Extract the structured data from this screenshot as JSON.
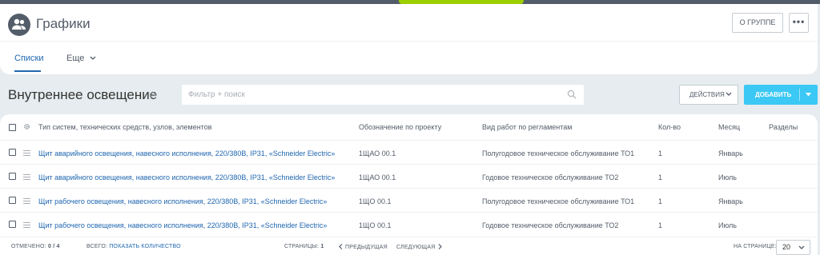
{
  "header": {
    "title": "Графики",
    "about_button": "О ГРУППЕ",
    "more_button": "•••",
    "tabs": [
      {
        "label": "Списки"
      },
      {
        "label": "Еще"
      }
    ]
  },
  "toolbar": {
    "section_title": "Внутреннее освещение",
    "filter_placeholder": "Фильтр + поиск",
    "actions_label": "ДЕЙСТВИЯ",
    "add_label": "ДОБАВИТЬ"
  },
  "grid": {
    "columns": [
      "Тип систем, технических средств, узлов, элементов",
      "Обозначение по проекту",
      "Вид работ по регламентам",
      "Кол-во",
      "Месяц",
      "Разделы"
    ],
    "rows": [
      {
        "name": "Щит аварийного освещения, навесного исполнения, 220/380В, IP31, «Schneider Electric»",
        "designation": "1ЩАО 00.1",
        "work": "Полугодовое техническое обслуживание ТО1",
        "qty": "1",
        "month": "Январь",
        "sections": ""
      },
      {
        "name": "Щит аварийного освещения, навесного исполнения, 220/380В, IP31, «Schneider Electric»",
        "designation": "1ЩАО 00.1",
        "work": "Годовое техническое обслуживание ТО2",
        "qty": "1",
        "month": "Июль",
        "sections": ""
      },
      {
        "name": "Щит рабочего освещения, навесного исполнения, 220/380В, IP31, «Schneider Electric»",
        "designation": "1ЩО 00.1",
        "work": "Полугодовое техническое обслуживание ТО1",
        "qty": "1",
        "month": "Январь",
        "sections": ""
      },
      {
        "name": "Щит рабочего освещения, навесного исполнения, 220/380В, IP31, «Schneider Electric»",
        "designation": "1ЩО 00.1",
        "work": "Годовое техническое обслуживание ТО2",
        "qty": "1",
        "month": "Июль",
        "sections": ""
      }
    ]
  },
  "footer": {
    "selected_label": "ОТМЕЧЕНО:",
    "selected_value": "0 / 4",
    "total_label": "ВСЕГО:",
    "total_link": "ПОКАЗАТЬ КОЛИЧЕСТВО",
    "pages_label": "СТРАНИЦЫ:",
    "pages_value": "1",
    "prev_label": "ПРЕДЫДУЩАЯ",
    "next_label": "СЛЕДУЮЩАЯ",
    "per_page_label": "НА СТРАНИЦЕ:",
    "per_page_value": "20"
  },
  "colors": {
    "topbar": "#535c69",
    "topbar_accent": "#9dcf00",
    "link": "#2067b0",
    "add_button": "#3bc8f5",
    "background": "#e6ecef"
  },
  "icons": {
    "avatar": "group-icon",
    "star": "star-outline-icon",
    "search": "search-icon",
    "settings": "gear-icon",
    "row_handle": "drag-handle-icon"
  }
}
